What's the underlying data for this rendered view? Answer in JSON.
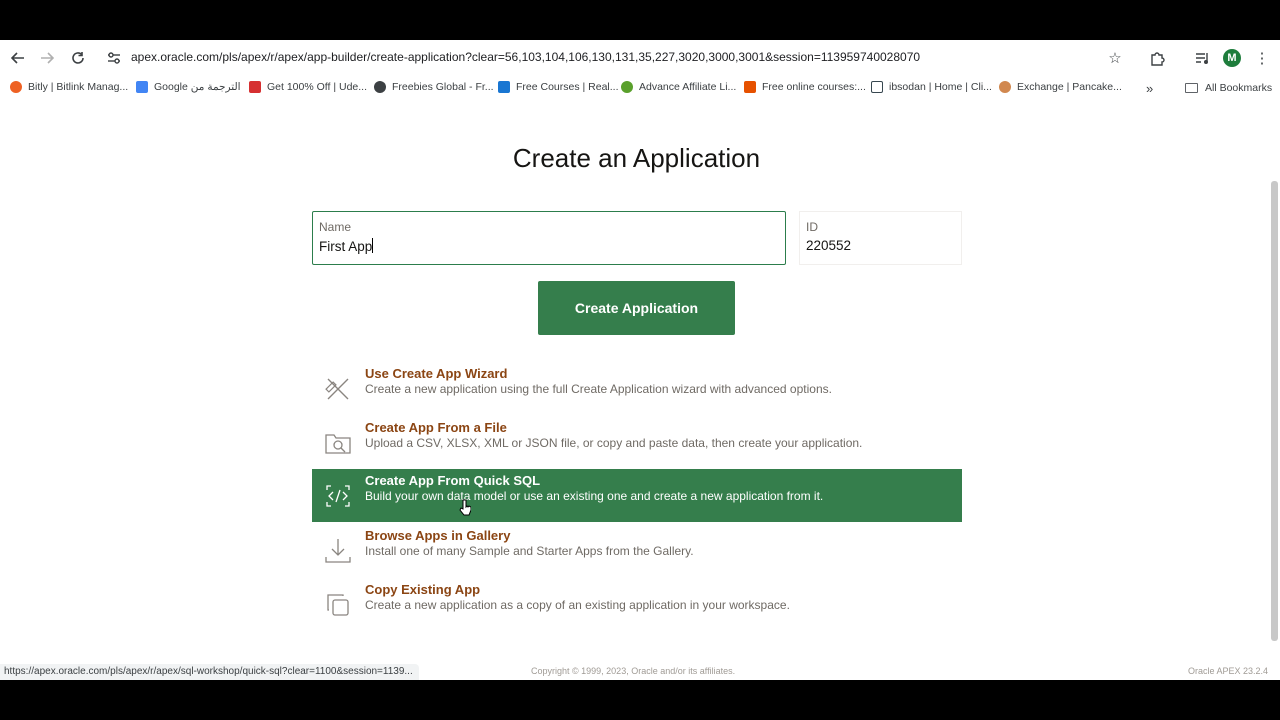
{
  "browser": {
    "url": "apex.oracle.com/pls/apex/r/apex/app-builder/create-application?clear=56,103,104,106,130,131,35,227,3020,3000,3001&session=113959740028070",
    "avatar_letter": "M",
    "bookmarks": [
      {
        "label": "Bitly | Bitlink Manag...",
        "color": "#ee6123"
      },
      {
        "label": "Google الترجمة من",
        "color": "#4285f4"
      },
      {
        "label": "Get 100% Off | Ude...",
        "color": "#d63031"
      },
      {
        "label": "Freebies Global - Fr...",
        "color": "#3c4043"
      },
      {
        "label": "Free Courses | Real...",
        "color": "#1976d2"
      },
      {
        "label": "Advance Affiliate Li...",
        "color": "#5aa02c"
      },
      {
        "label": "Free online courses:...",
        "color": "#e65100"
      },
      {
        "label": "ibsodan | Home | Cli...",
        "color": "#37474f"
      },
      {
        "label": "Exchange | Pancake...",
        "color": "#d1884f"
      }
    ],
    "more_label": "»",
    "all_bookmarks_label": "All Bookmarks",
    "status_url": "https://apex.oracle.com/pls/apex/r/apex/sql-workshop/quick-sql?clear=1100&session=1139..."
  },
  "page": {
    "title": "Create an Application",
    "name_label": "Name",
    "name_value": "First App",
    "id_label": "ID",
    "id_value": "220552",
    "create_button": "Create Application",
    "options": [
      {
        "title": "Use Create App Wizard",
        "desc": "Create a new application using the full Create Application wizard with advanced options.",
        "icon": "wizard-icon"
      },
      {
        "title": "Create App From a File",
        "desc": "Upload a CSV, XLSX, XML or JSON file, or copy and paste data, then create your application.",
        "icon": "file-icon"
      },
      {
        "title": "Create App From Quick SQL",
        "desc": "Build your own data model or use an existing one and create a new application from it.",
        "icon": "code-icon"
      },
      {
        "title": "Browse Apps in Gallery",
        "desc": "Install one of many Sample and Starter Apps from the Gallery.",
        "icon": "download-icon"
      },
      {
        "title": "Copy Existing App",
        "desc": "Create a new application as a copy of an existing application in your workspace.",
        "icon": "copy-icon"
      }
    ],
    "copyright": "Copyright © 1999, 2023, Oracle and/or its affiliates.",
    "version": "Oracle APEX 23.2.4"
  }
}
